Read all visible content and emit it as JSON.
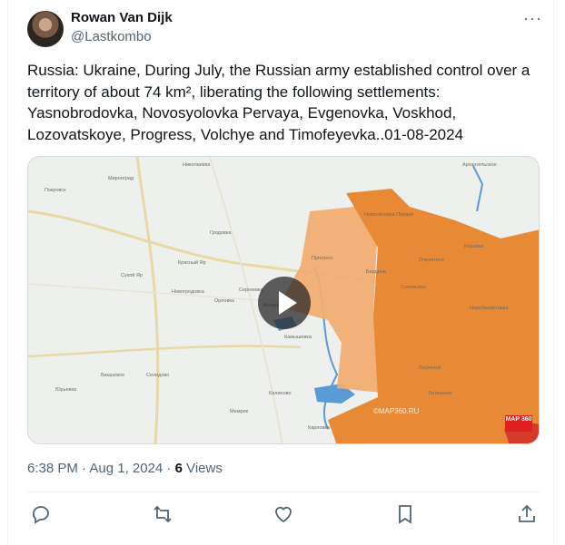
{
  "author": {
    "name": "Rowan Van Dijk",
    "handle": "@Lastkombo"
  },
  "tweet_text": "Russia: Ukraine,  During July, the Russian army established control over a territory of about 74 km², liberating the following settlements: Yasnobrodovka, Novosyolovka Pervaya, Evgenovka, Voskhod, Lozovatskoye, Progress, Volchye and Timofeyevka..01-08-2024",
  "map_labels": [
    "Мирноград",
    "Покровск",
    "Гродовка",
    "Новогродовка",
    "Селидово",
    "Вишневое",
    "Камышевка",
    "Карловка",
    "Очеретино",
    "Прогресс",
    "Николаевка",
    "Красный Яр",
    "Сукой Яр",
    "Желанное",
    "Орловка",
    "Калиново",
    "Мемрик",
    "Юрьевка",
    "Сергеевка",
    "Новосёловка Первая",
    "Бердичи",
    "Соловьёво",
    "Керамик",
    "Новобахмутовка",
    "Архангельское",
    "Тоненькое",
    "Лисичное"
  ],
  "watermark": "©MAP360.RU",
  "logo": "MAP 360",
  "meta": {
    "time": "6:38 PM · Aug 1, 2024 · ",
    "views_count": "6",
    "views_label": " Views"
  },
  "icons": [
    "more-icon",
    "reply-icon",
    "retweet-icon",
    "like-icon",
    "bookmark-icon",
    "share-icon"
  ],
  "colors": {
    "occupied": "#e88a35",
    "contested": "#f0ad72",
    "water": "#5b9bd5",
    "text_secondary": "#536471"
  }
}
